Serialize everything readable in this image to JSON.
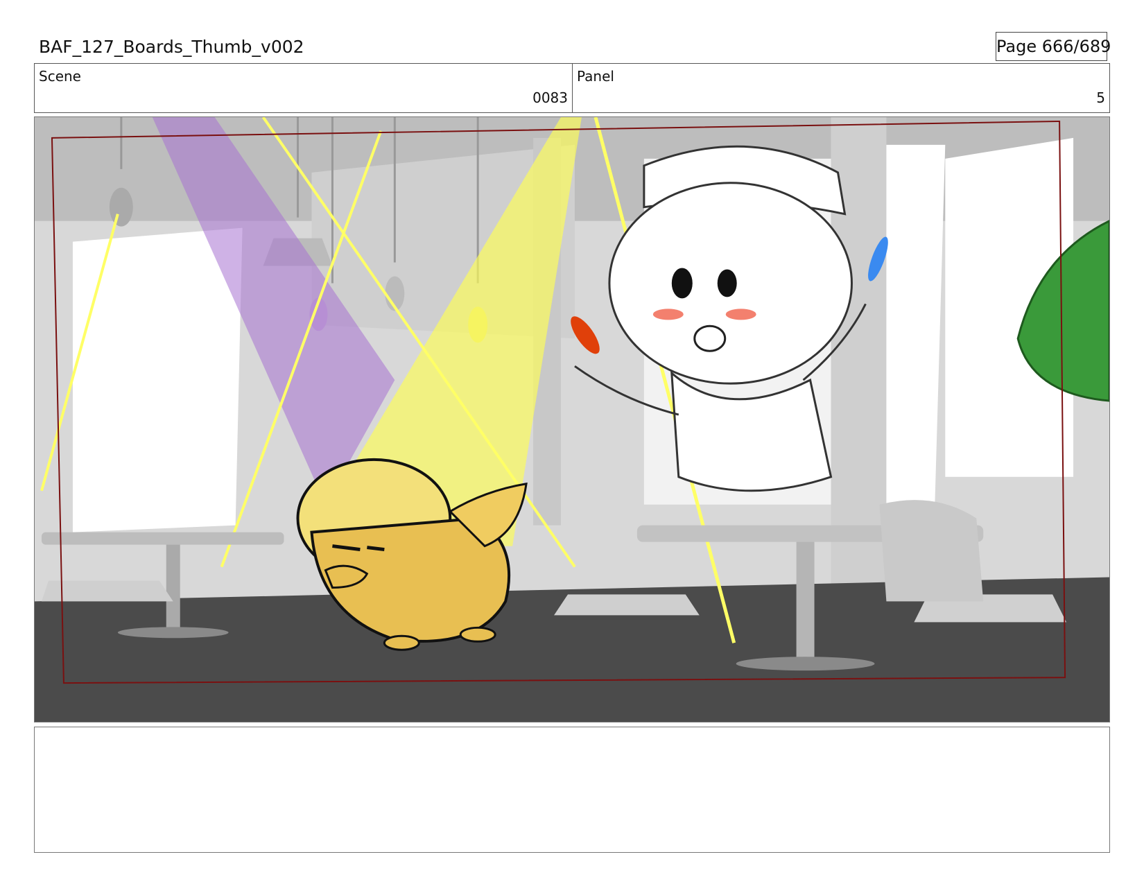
{
  "header": {
    "title": "BAF_127_Boards_Thumb_v002",
    "page": "Page 666/689"
  },
  "info": {
    "scene_label": "Scene",
    "scene_value": "0083",
    "panel_label": "Panel",
    "panel_value": "5"
  },
  "notes": {
    "text": ""
  },
  "colors": {
    "frame_border": "#777777",
    "safe_frame": "#7a1010",
    "spotlight_yellow": "#ffff66",
    "spotlight_purple": "#a872d2",
    "duck": "#f2c24a",
    "frog": "#3a9a3a"
  }
}
